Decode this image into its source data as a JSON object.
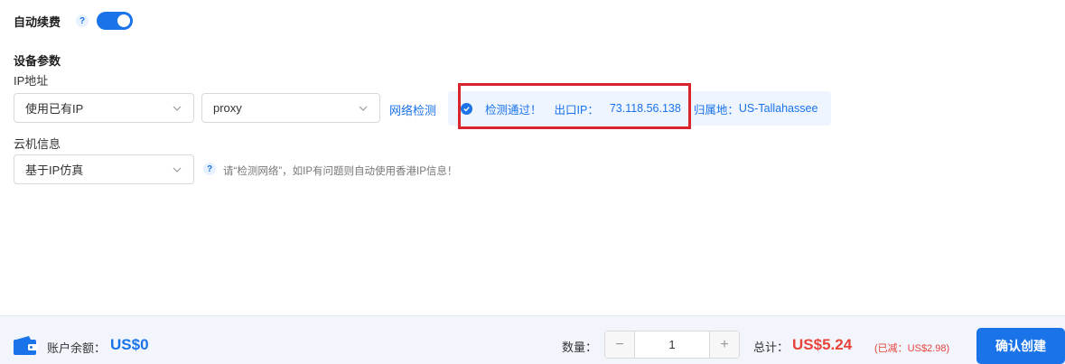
{
  "auto_renew": {
    "label": "自动续费",
    "help": "?",
    "enabled": true
  },
  "device_params": {
    "section_title": "设备参数",
    "ip_label": "IP地址",
    "ip_mode_select": "使用已有IP",
    "proxy_select": "proxy",
    "network_check_link": "网络检测",
    "check_result": {
      "status": "检测通过！",
      "exit_ip_label": "出口IP：",
      "exit_ip": "73.118.56.138",
      "location_label": "归属地：",
      "location": "US-Tallahassee"
    },
    "cloud_info_label": "云机信息",
    "cloud_info_select": "基于IP仿真",
    "hint_help": "?",
    "hint_text": "请“检测网络”，如IP有问题则自动使用香港IP信息！"
  },
  "footer": {
    "balance_label": "账户余额：",
    "balance_value": "US$0",
    "quantity_label": "数量：",
    "quantity_value": "1",
    "minus": "−",
    "plus": "+",
    "total_label": "总计：",
    "total_value": "US$5.24",
    "discount": "(已减：US$2.98)",
    "confirm_button": "确认创建"
  },
  "colors": {
    "primary": "#1a73e8",
    "price": "#e8433a",
    "highlight": "#d9232d"
  }
}
